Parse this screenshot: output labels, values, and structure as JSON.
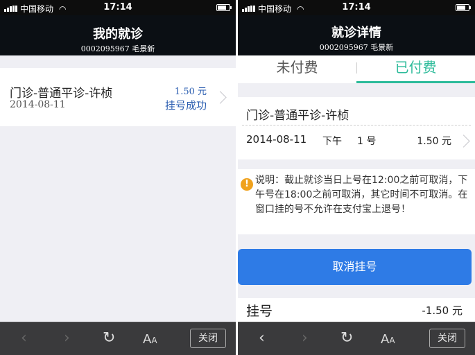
{
  "status_bar": {
    "carrier": "中国移动",
    "time": "17:14"
  },
  "left": {
    "nav": {
      "title": "我的就诊",
      "subtitle": "0002095967 毛景新"
    },
    "visit": {
      "title": "门诊-普通平诊-许桢",
      "date": "2014-08-11",
      "price": "1.50 元",
      "status": "挂号成功"
    }
  },
  "right": {
    "nav": {
      "title": "就诊详情",
      "subtitle": "0002095967 毛景新"
    },
    "tabs": {
      "unpaid": "未付费",
      "paid": "已付费"
    },
    "detail": {
      "title": "门诊-普通平诊-许桢",
      "date": "2014-08-11",
      "period": "下午",
      "number": "1 号",
      "price": "1.50 元"
    },
    "notice": "说明：截止就诊当日上号在12:00之前可取消，下午号在18:00之前可取消，其它时间不可取消。在窗口挂的号不允许在支付宝上退号！",
    "cancel_button": "取消挂号",
    "fee": {
      "label": "挂号",
      "value": "-1.50 元"
    }
  },
  "toolbar": {
    "font_label": "A",
    "font_small": "A",
    "close_label": "关闭"
  },
  "colors": {
    "accent_green": "#2dbb9a",
    "button_blue": "#2e7be6",
    "link_blue": "#2a5db0",
    "warning_orange": "#f0a21e"
  },
  "icons": [
    "signal-icon",
    "wifi-icon",
    "battery-icon",
    "chevron-right-icon",
    "back-arrow-icon",
    "forward-arrow-icon",
    "refresh-icon",
    "font-size-icon",
    "warning-icon"
  ]
}
